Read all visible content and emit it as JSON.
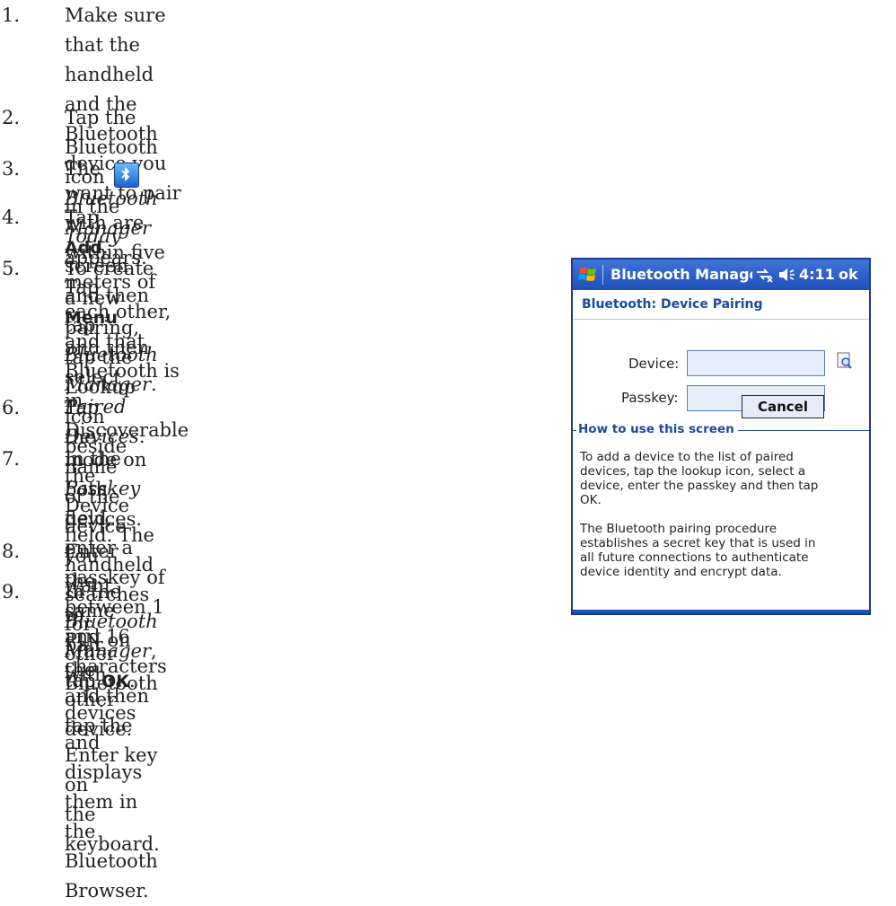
{
  "steps": [
    {
      "num": "1.",
      "lines": [
        "Make sure that the handheld and the Bluetooth device you want to pair with are",
        "within five meters of each other, and that Bluetooth is in Discoverable mode on",
        "both devices."
      ]
    },
    {
      "num": "2.",
      "pre": "Tap the Bluetooth icon",
      "mid": "in the",
      "em1": "Today",
      "mid2": "screen and then tap",
      "em2": "Bluetooth Manager",
      "post": "."
    },
    {
      "num": "3.",
      "pre": "The",
      "em1": "Bluetooth Manager",
      "mid": "appears. Tap",
      "bold": "Menu",
      "mid2": "and then select",
      "em2": "Paired Devices",
      "post": "."
    },
    {
      "num": "4.",
      "pre": "Tap",
      "bold": "Add",
      "post": "."
    },
    {
      "num": "5.",
      "lines": [
        "To create a new pairing, tap the Lookup icon",
        "beside the Device field. The handheld searches for",
        "other Bluetooth devices and displays them in the",
        "Bluetooth Browser."
      ]
    },
    {
      "num": "6.",
      "text": "Tap the name of the device you want to pair with."
    },
    {
      "num": "7.",
      "pre": "In the",
      "em1": "Passkey",
      "line1_post": "field, enter a passkey of between 1",
      "lines_rest": [
        "and 16 characters and then tap the Enter key on",
        "the keyboard."
      ]
    },
    {
      "num": "8.",
      "text": "Enter the same PIN on the other device."
    },
    {
      "num": "9.",
      "pre": "In the",
      "em1": "Bluetooth Manager",
      "mid": ", tap",
      "bold": "OK",
      "post": "."
    }
  ],
  "phone": {
    "title": "Bluetooth Manager",
    "time": "4:11",
    "ok": "ok",
    "subhead": "Bluetooth: Device Pairing",
    "device_label": "Device:",
    "passkey_label": "Passkey:",
    "cancel": "Cancel",
    "howto_title": "How to use this screen",
    "howto_p1": [
      "To add a device to the list of paired",
      "devices, tap the lookup icon, select a",
      "device, enter the passkey and then tap",
      "OK."
    ],
    "howto_p2": [
      "The Bluetooth pairing procedure",
      "establishes a secret key that is used in",
      "all future connections to authenticate",
      "device identity and encrypt data."
    ]
  },
  "colors": {
    "titlebar": "#1e52b8",
    "accent_text": "#1b49a6",
    "field_fill": "#e6eefb"
  },
  "icons": [
    "bluetooth-icon",
    "windows-flag-icon",
    "connectivity-icon",
    "speaker-icon",
    "lookup-icon"
  ]
}
